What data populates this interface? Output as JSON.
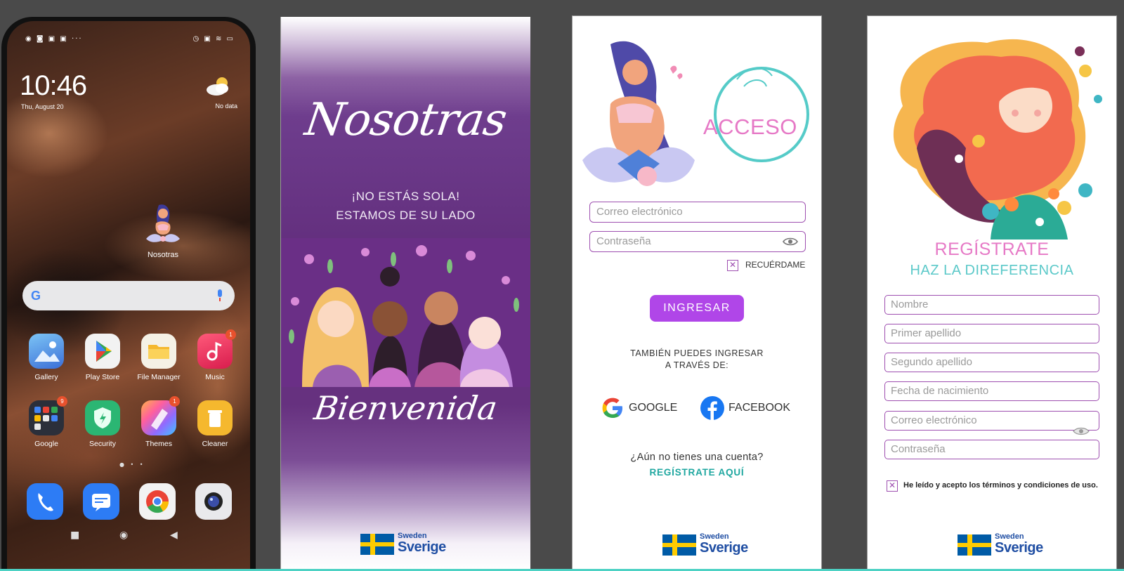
{
  "phone": {
    "status_left": "◉ ◙ ▣ ▣ ···",
    "status_right": "◷ ▣ ≋ ▭",
    "clock": "10:46",
    "date": "Thu, August 20",
    "weather_label": "No data",
    "app_nosotras_label": "Nosotras",
    "search_g": "G",
    "apps": [
      {
        "label": "Gallery",
        "color": "#3b8de0",
        "badge": ""
      },
      {
        "label": "Play Store",
        "color": "#f2f2f2",
        "badge": ""
      },
      {
        "label": "File Manager",
        "color": "#f5b82e",
        "badge": ""
      },
      {
        "label": "Music",
        "color": "#e8395c",
        "badge": "1"
      },
      {
        "label": "Google",
        "color": "#2b2f3a",
        "badge": "9"
      },
      {
        "label": "Security",
        "color": "#2bb673",
        "badge": ""
      },
      {
        "label": "Themes",
        "color": "#c46be6",
        "badge": "1"
      },
      {
        "label": "Cleaner",
        "color": "#f5b82e",
        "badge": ""
      }
    ],
    "page_dots": "● • •",
    "dock": [
      {
        "name": "phone-app",
        "color": "#2d7cf5"
      },
      {
        "name": "messages-app",
        "color": "#2d7cf5"
      },
      {
        "name": "chrome-app",
        "color": "#f2f2f2"
      },
      {
        "name": "camera-app",
        "color": "#e9e9ec"
      }
    ],
    "nav": [
      "■",
      "◉",
      "◀"
    ]
  },
  "splash": {
    "title": "Nosotras",
    "tagline_1": "¡NO ESTÁS SOLA!",
    "tagline_2": "ESTAMOS DE SU LADO",
    "welcome": "Bienvenida",
    "logo_small": "Sweden",
    "logo_big": "Sverige"
  },
  "login": {
    "title": "ACCESO",
    "email_placeholder": "Correo electrónico",
    "password_placeholder": "Contraseña",
    "remember_check": "✕",
    "remember_label": "RECUÉRDAME",
    "submit_label": "INGRESAR",
    "also_line_1": "TAMBIÉN PUEDES INGRESAR",
    "also_line_2": "A TRAVÉS DE:",
    "google_label": "GOOGLE",
    "facebook_label": "FACEBOOK",
    "no_account": "¿Aún no tienes una cuenta?",
    "register_link": "REGÍSTRATE AQUÍ",
    "logo_small": "Sweden",
    "logo_big": "Sverige"
  },
  "register": {
    "title": "REGÍSTRATE",
    "subtitle": "HAZ LA DIREFERENCIA",
    "fields": [
      "Nombre",
      "Primer apellido",
      "Segundo apellido",
      "Fecha de nacimiento",
      "Correo electrónico",
      "Contraseña"
    ],
    "terms_check": "✕",
    "terms_label": "He leído y acepto los términos y condiciones de uso.",
    "logo_small": "Sweden",
    "logo_big": "Sverige"
  },
  "colors": {
    "purple_dark": "#64307f",
    "accent_purple": "#b046e8",
    "field_border": "#9e4fb0",
    "pink_title": "#e679c6",
    "teal": "#1fa7a0",
    "sweden_blue": "#005ba6",
    "sweden_yellow": "#fecb00"
  }
}
